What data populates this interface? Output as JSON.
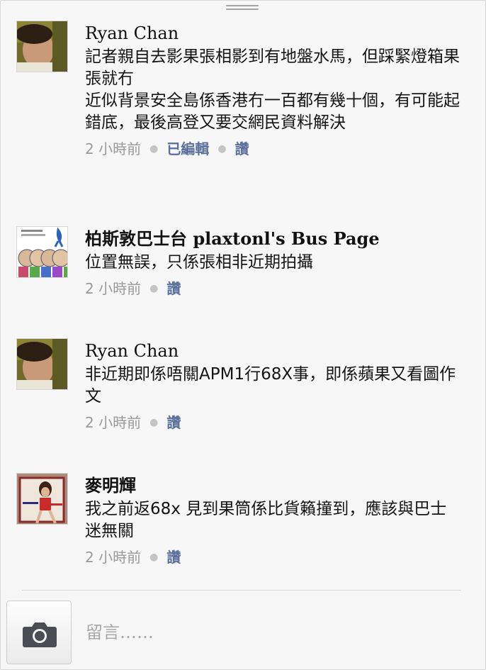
{
  "comments": [
    {
      "author": "Ryan Chan",
      "text": "記者親自去影果張相影到有地盤水馬，但踩緊燈箱果張就冇\n近似背景安全島係香港冇一百都有幾十個，有可能起錯底，最後高登又要交網民資料解決",
      "time": "2 小時前",
      "edited": "已編輯",
      "like": "讚"
    },
    {
      "author": "柏斯敦巴士台 plaxtonl's Bus Page",
      "text": "位置無誤，只係張相非近期拍攝",
      "time": "2 小時前",
      "like": "讚"
    },
    {
      "author": "Ryan Chan",
      "text": "非近期即係唔關APM1行68X事，即係蘋果又看圖作文",
      "time": "2 小時前",
      "like": "讚"
    },
    {
      "author": "麥明輝",
      "text": "我之前返68x 見到果筒係比貨籟撞到，應該與巴士迷無關",
      "time": "2 小時前",
      "like": "讚"
    }
  ],
  "composer": {
    "placeholder": "留言……",
    "camera_icon": "camera-icon"
  },
  "colors": {
    "link": "#5b6f9c",
    "meta": "#9a9a9a",
    "background": "#f7f7f7"
  }
}
